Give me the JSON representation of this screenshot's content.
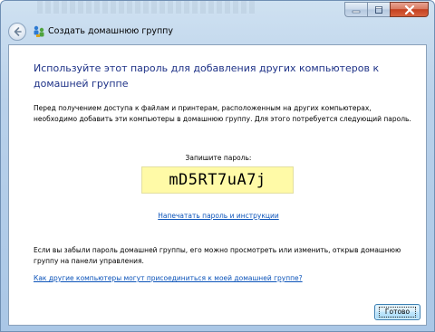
{
  "window": {
    "title": "Создать домашнюю группу",
    "controls": [
      "minimize-icon",
      "maximize-icon",
      "close-icon"
    ]
  },
  "content": {
    "heading": "Используйте этот пароль для добавления других компьютеров к домашней группе",
    "intro": "Перед получением доступа к файлам и принтерам, расположенным на других компьютерах, необходимо добавить эти компьютеры в домашнюю группу. Для этого потребуется следующий пароль.",
    "password_label": "Запишите пароль:",
    "password": "mD5RT7uA7j",
    "print_link": "Напечатать пароль и инструкции",
    "forgot_text": "Если вы забыли пароль домашней группы, его можно просмотреть или изменить, открыв домашнюю группу на панели управления.",
    "how_link": "Как другие компьютеры могут присоединиться к моей домашней группе?"
  },
  "buttons": {
    "done": "Готово"
  },
  "colors": {
    "heading": "#1e3287",
    "link": "#0b53b9",
    "password_bg": "#fffaa7"
  }
}
